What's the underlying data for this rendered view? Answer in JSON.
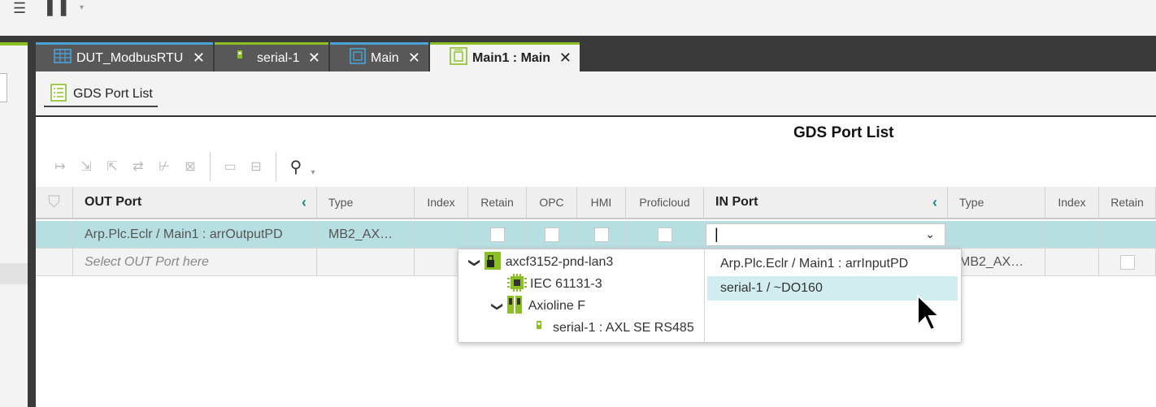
{
  "tabs": [
    {
      "label": "DUT_ModbusRTU",
      "icon": "table-icon"
    },
    {
      "label": "serial-1",
      "icon": "device-icon"
    },
    {
      "label": "Main",
      "icon": "program-icon"
    },
    {
      "label": "Main1 : Main",
      "icon": "instance-icon",
      "active": true
    }
  ],
  "close_glyph": "✕",
  "subtab": {
    "label": "GDS Port List",
    "icon": "list-icon"
  },
  "page_title": "GDS Port List",
  "columns": {
    "out_port": "OUT Port",
    "type": "Type",
    "index": "Index",
    "retain": "Retain",
    "opc": "OPC",
    "hmi": "HMI",
    "proficloud": "Proficloud",
    "in_port": "IN Port",
    "type2": "Type",
    "index2": "Index",
    "retain2": "Retain"
  },
  "rows": [
    {
      "out_port": "Arp.Plc.Eclr / Main1 : arrOutputPD",
      "type": "MB2_AX…",
      "in_port_value": "|",
      "selected": true
    },
    {
      "out_port_placeholder": "Select OUT Port here",
      "type2": "MB2_AX…"
    }
  ],
  "tree": [
    {
      "label": "axcf3152-pnd-lan3",
      "icon": "controller-icon",
      "expanded": true
    },
    {
      "label": "IEC 61131-3",
      "icon": "chip-icon"
    },
    {
      "label": "Axioline F",
      "icon": "axioline-icon",
      "expanded": true
    },
    {
      "label": "serial-1 : AXL SE RS485",
      "icon": "device-icon"
    }
  ],
  "port_options": [
    {
      "label": "Arp.Plc.Eclr / Main1 : arrInputPD"
    },
    {
      "label": "serial-1 / ~DO160",
      "highlighted": true
    }
  ],
  "colors": {
    "accent_green": "#8cbf26",
    "accent_teal": "#1d8c8c",
    "selection": "#b7dfe2",
    "highlight": "#d2edef"
  }
}
